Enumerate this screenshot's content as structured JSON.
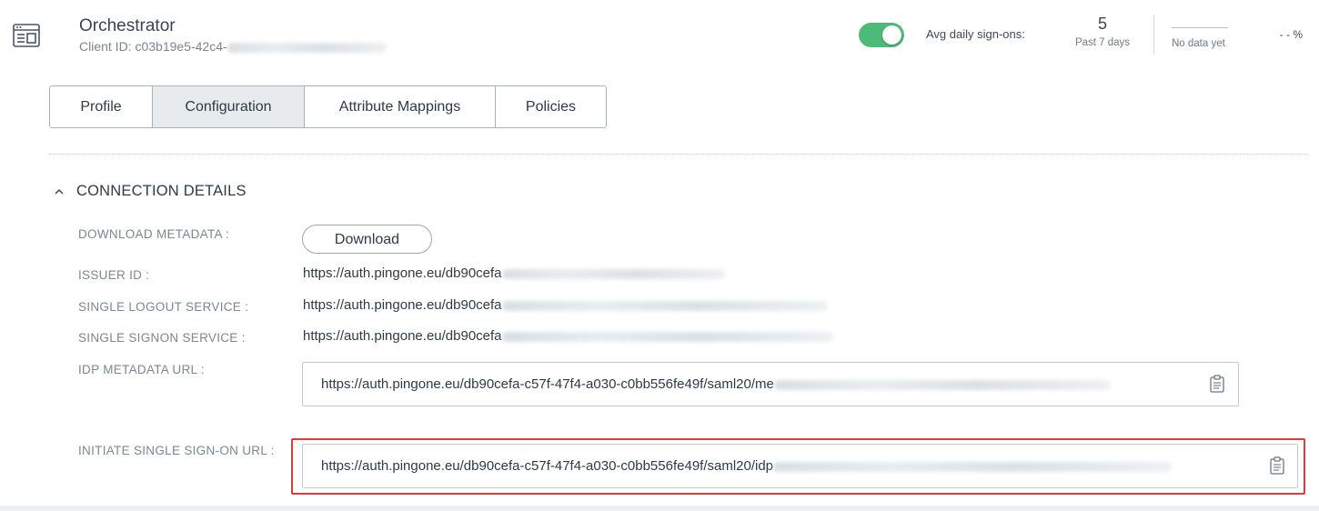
{
  "app": {
    "name": "Orchestrator",
    "client_id_label": "Client ID: c03b19e5-42c4-",
    "enabled": true,
    "icon": "application-icon"
  },
  "stats": {
    "avg_label": "Avg daily sign-ons:",
    "count": "5",
    "period": "Past 7 days",
    "no_data": "No data yet",
    "percent": "- - %"
  },
  "tabs": [
    {
      "label": "Profile",
      "active": false
    },
    {
      "label": "Configuration",
      "active": true
    },
    {
      "label": "Attribute Mappings",
      "active": false
    },
    {
      "label": "Policies",
      "active": false
    }
  ],
  "section": {
    "title": "CONNECTION DETAILS",
    "icon": "chevron-up-icon",
    "fields": {
      "download_metadata": {
        "label": "DOWNLOAD METADATA :",
        "button": "Download"
      },
      "issuer_id": {
        "label": "ISSUER ID :",
        "value": "https://auth.pingone.eu/db90cefa"
      },
      "single_logout": {
        "label": "SINGLE LOGOUT SERVICE :",
        "value": "https://auth.pingone.eu/db90cefa"
      },
      "single_signon": {
        "label": "SINGLE SIGNON SERVICE :",
        "value": "https://auth.pingone.eu/db90cefa"
      },
      "idp_metadata_url": {
        "label": "IDP METADATA URL :",
        "value": "https://auth.pingone.eu/db90cefa-c57f-47f4-a030-c0bb556fe49f/saml20/me"
      },
      "initiate_sso_url": {
        "label": "INITIATE SINGLE SIGN-ON URL :",
        "value": "https://auth.pingone.eu/db90cefa-c57f-47f4-a030-c0bb556fe49f/saml20/idp"
      }
    }
  },
  "colors": {
    "toggle_on": "#4cbb78",
    "highlight": "#e03a3a",
    "active_tab": "#e8ebee"
  }
}
